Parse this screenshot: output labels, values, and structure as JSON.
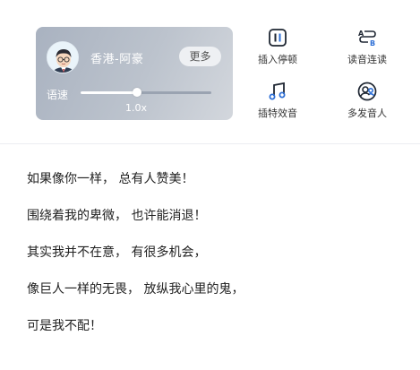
{
  "voice": {
    "name": "香港-阿豪",
    "more_label": "更多",
    "speed_label": "语速",
    "speed_value": "1.0x",
    "speed_fraction": 0.43
  },
  "tools": [
    {
      "label": "插入停顿",
      "icon": "pause-insert-icon"
    },
    {
      "label": "读音连读",
      "icon": "linked-reading-icon"
    },
    {
      "label": "插特效音",
      "icon": "music-note-icon"
    },
    {
      "label": "多发音人",
      "icon": "multi-speaker-icon"
    }
  ],
  "lyrics": [
    "如果像你一样， 总有人赞美！",
    "围绕着我的卑微， 也许能消退！",
    "其实我并不在意， 有很多机会，",
    "像巨人一样的无畏， 放纵我心里的鬼，",
    "可是我不配！"
  ],
  "colors": {
    "accent": "#2d6fd6",
    "card_gradient_start": "#a9b2c0",
    "card_gradient_end": "#d3d7dd"
  }
}
